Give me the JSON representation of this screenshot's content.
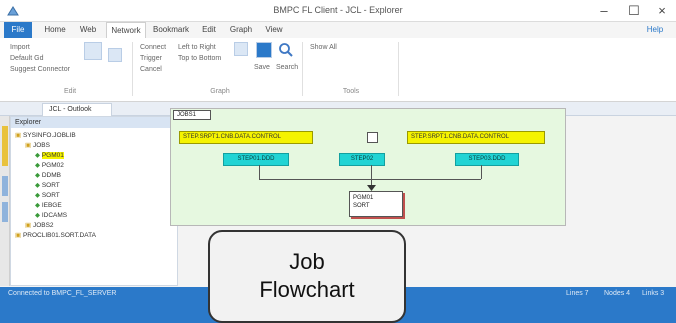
{
  "window": {
    "title": "BMPC FL Client - JCL - Explorer",
    "minimize_glyph": "–",
    "maximize_glyph": "☐",
    "close_glyph": "×"
  },
  "ribbon_tabs": [
    "File",
    "Home",
    "Web",
    "Network",
    "Bookmark",
    "Edit",
    "Graph",
    "View"
  ],
  "ribbon": {
    "edit_group": {
      "items": [
        "Import",
        "Default Gd",
        "Suggest Connector"
      ],
      "label": "Edit"
    },
    "graph_group": {
      "items_a": [
        "Connect",
        "Trigger",
        "Cancel"
      ],
      "items_b": [
        "Left to Right",
        "Top to Bottom"
      ],
      "big": [
        "Save",
        "Search"
      ],
      "label": "Graph"
    },
    "tools_group": {
      "items": [
        "Show All"
      ],
      "label": "Tools"
    },
    "help_label": "Help"
  },
  "doc_tab": {
    "label": "JCL - Outlook"
  },
  "tree": {
    "header": "Explorer",
    "items": [
      "SYSINFO.JOBLIB",
      "JOBS",
      "PGM01",
      "PGM02",
      "DDMB",
      "SORT",
      "SORT",
      "IEBGE",
      "IDCAMS",
      "JOBS2",
      "PROCLIB01.SORT.DATA"
    ]
  },
  "flow": {
    "frame_label": "JOBS1",
    "job_top_left": "STEP.SRPT1.CNB.DATA.CONTROL",
    "job_top_right": "STEP.SRPT1.CNB.DATA.CONTROL",
    "step_left": "STEP01.DDD",
    "step_mid": "STEP02",
    "step_right": "STEP03.DDD",
    "target_line1": "PGM01",
    "target_line2": "SORT"
  },
  "statusbar": {
    "left": "Connected to BMPC_FL_SERVER",
    "right": [
      "Lines 7",
      "Nodes 4",
      "Links 3"
    ]
  },
  "callout": {
    "line1": "Job",
    "line2": "Flowchart"
  }
}
